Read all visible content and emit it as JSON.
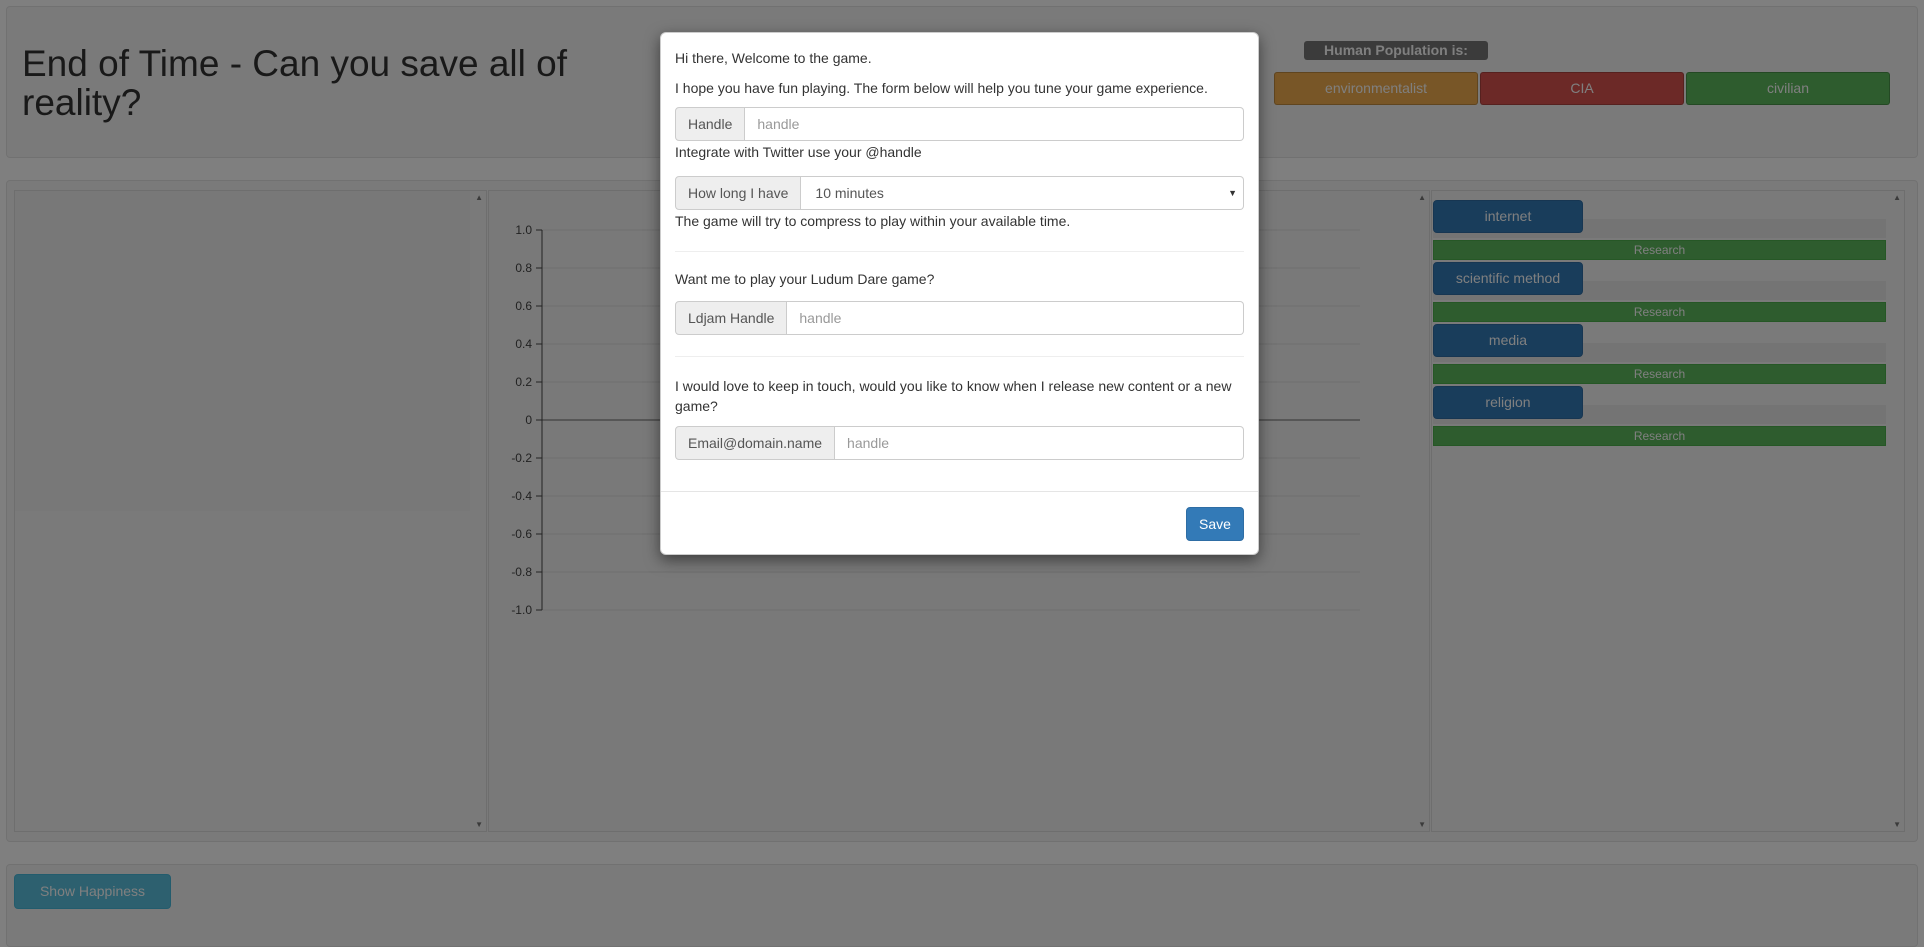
{
  "header": {
    "title": "End of Time - Can you save all of reality?",
    "population_label": "Human Population is:",
    "population_buttons": [
      {
        "label": "environmentalist",
        "color": "#f0ad4e"
      },
      {
        "label": "CIA",
        "color": "#d9534f"
      },
      {
        "label": "civilian",
        "color": "#5cb85c"
      }
    ]
  },
  "chart_data": {
    "type": "line",
    "yticks": [
      "1.0",
      "0.8",
      "0.6",
      "0.4",
      "0.2",
      "0",
      "-0.2",
      "-0.4",
      "-0.6",
      "-0.8",
      "-1.0"
    ],
    "ylim": [
      -1.0,
      1.0
    ],
    "series": []
  },
  "research": {
    "items": [
      {
        "name": "internet",
        "action": "Research"
      },
      {
        "name": "scientific method",
        "action": "Research"
      },
      {
        "name": "media",
        "action": "Research"
      },
      {
        "name": "religion",
        "action": "Research"
      }
    ]
  },
  "footer": {
    "show_happiness_label": "Show Happiness"
  },
  "modal": {
    "greeting": "Hi there, Welcome to the game.",
    "intro": "I hope you have fun playing. The form below will help you tune your game experience.",
    "handle": {
      "addon": "Handle",
      "placeholder": "handle",
      "value": ""
    },
    "handle_help": "Integrate with Twitter use your @handle",
    "time": {
      "addon": "How long I have",
      "selected": "10 minutes"
    },
    "time_help": "The game will try to compress to play within your available time.",
    "ldjam_question": "Want me to play your Ludum Dare game?",
    "ldjam": {
      "addon": "Ldjam Handle",
      "placeholder": "handle",
      "value": ""
    },
    "keep_in_touch": "I would love to keep in touch, would you like to know when I release new content or a new game?",
    "email": {
      "addon": "Email@domain.name",
      "placeholder": "handle",
      "value": ""
    },
    "save_label": "Save"
  }
}
